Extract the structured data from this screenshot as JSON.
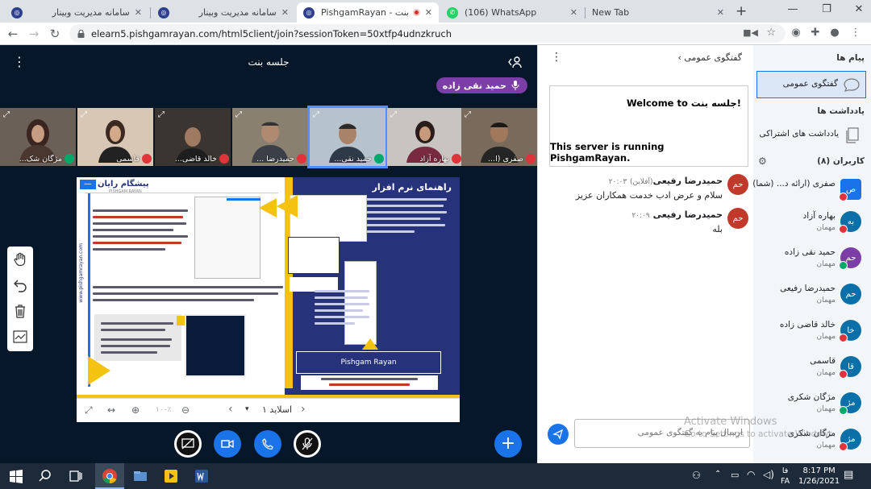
{
  "tabs": [
    {
      "title": "سامانه مدیریت وبینار",
      "active": false
    },
    {
      "title": "سامانه مدیریت وبینار",
      "active": false
    },
    {
      "title": "PishgamRayan - جلسه بنت",
      "active": true
    },
    {
      "title": "(106) WhatsApp",
      "active": false
    },
    {
      "title": "New Tab",
      "active": false
    }
  ],
  "address": {
    "url": "elearn5.pishgamrayan.com/html5client/join?sessionToken=50xtfp4udnzkruch"
  },
  "meeting": {
    "title": "جلسه بنت",
    "presenter": "حمید نقی زاده"
  },
  "videos": [
    {
      "label": "مژگان شک..."
    },
    {
      "label": "قاسمی"
    },
    {
      "label": "خالد قاضی..."
    },
    {
      "label": "حمیدرضا ..."
    },
    {
      "label": "حمید نقی..."
    },
    {
      "label": "بهاره آزاد"
    },
    {
      "label": "صفری (ا..."
    }
  ],
  "slide": {
    "counter": "اسلاید ۱",
    "zoom": "۱۰۰٪",
    "brand": "پیشگام رایان",
    "brand_en": "PISHGAM RAYAN",
    "heading": "راهنمای نرم افزار",
    "site": "www.pishgamrayan.com",
    "logo_text": "Pishgam Rayan"
  },
  "chat": {
    "title": "گفتگوی عمومی",
    "welcome": "Welcome to جلسه بنت!",
    "server": "This server is running PishgamRayan.",
    "messages": [
      {
        "avatar": "حم",
        "name": "حمیدرضا رفیعی",
        "status": "(آفلاین)",
        "time": "۲۰:۰۳",
        "text": "سلام و عرض ادب خدمت همکاران عزیز"
      },
      {
        "avatar": "حم",
        "name": "حمیدرضا رفیعی",
        "status": "",
        "time": "۲۰:۰۹",
        "text": "بله"
      }
    ],
    "placeholder": "ارسال پیام به گفتگوی عمومی"
  },
  "sidebar": {
    "messages_title": "پیام ها",
    "public_chat": "گفتگوی عمومی",
    "notes_title": "یادداشت ها",
    "shared_notes": "یادداشت های اشتراکی",
    "users_title": "کاربران (۸)",
    "users": [
      {
        "avatar": "ص",
        "name": "صفری (ارائه د... (شما)",
        "role": "",
        "color": "#1a73e8"
      },
      {
        "avatar": "به",
        "name": "بهاره آزاد",
        "role": "مهمان",
        "color": "#0b6fa8"
      },
      {
        "avatar": "حم",
        "name": "حمید نقی زاده",
        "role": "مهمان",
        "color": "#7a3ea6"
      },
      {
        "avatar": "حم",
        "name": "حمیدرضا رفیعی",
        "role": "مهمان",
        "color": "#0b6fa8"
      },
      {
        "avatar": "خا",
        "name": "خالد قاضی زاده",
        "role": "مهمان",
        "color": "#0b6fa8"
      },
      {
        "avatar": "قا",
        "name": "قاسمی",
        "role": "مهمان",
        "color": "#0b6fa8"
      },
      {
        "avatar": "مژ",
        "name": "مژگان شکری",
        "role": "مهمان",
        "color": "#0b6fa8"
      },
      {
        "avatar": "مژ",
        "name": "مژگان شکری",
        "role": "مهمان",
        "color": "#0b6fa8"
      }
    ]
  },
  "watermark": {
    "line1": "Activate Windows",
    "line2": "Go to Settings to activate Windows."
  },
  "taskbar": {
    "time": "8:17 PM",
    "date": "1/26/2021",
    "lang": "FA",
    "lang2": "فا"
  }
}
